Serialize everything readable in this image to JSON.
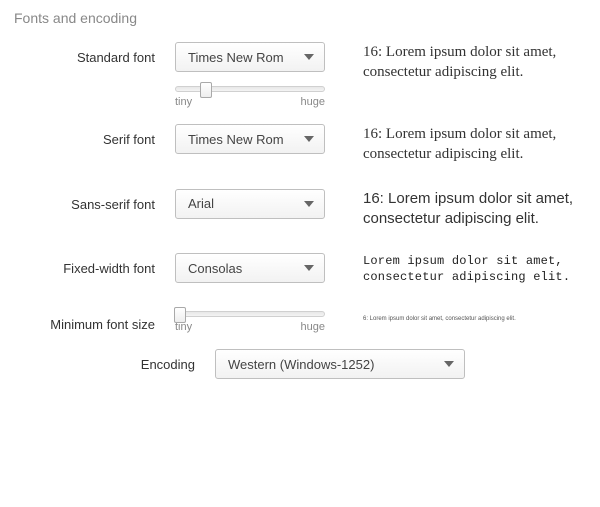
{
  "section": {
    "title": "Fonts and encoding"
  },
  "standard": {
    "label": "Standard font",
    "value": "Times New Rom",
    "preview": "16: Lorem ipsum dolor sit amet, consectetur adipiscing elit.",
    "slider": {
      "min_label": "tiny",
      "max_label": "huge",
      "position_pct": 20
    }
  },
  "serif": {
    "label": "Serif font",
    "value": "Times New Rom",
    "preview": "16: Lorem ipsum dolor sit amet, consectetur adipiscing elit."
  },
  "sans": {
    "label": "Sans-serif font",
    "value": "Arial",
    "preview": "16: Lorem ipsum dolor sit amet, consectetur adipiscing elit."
  },
  "fixed": {
    "label": "Fixed-width font",
    "value": "Consolas",
    "preview": "Lorem ipsum dolor sit amet, consectetur adipiscing elit."
  },
  "minsize": {
    "label": "Minimum font size",
    "preview": "6: Lorem ipsum dolor sit amet, consectetur adipiscing elit.",
    "slider": {
      "min_label": "tiny",
      "max_label": "huge",
      "position_pct": 3
    }
  },
  "encoding": {
    "label": "Encoding",
    "value": "Western (Windows-1252)"
  }
}
